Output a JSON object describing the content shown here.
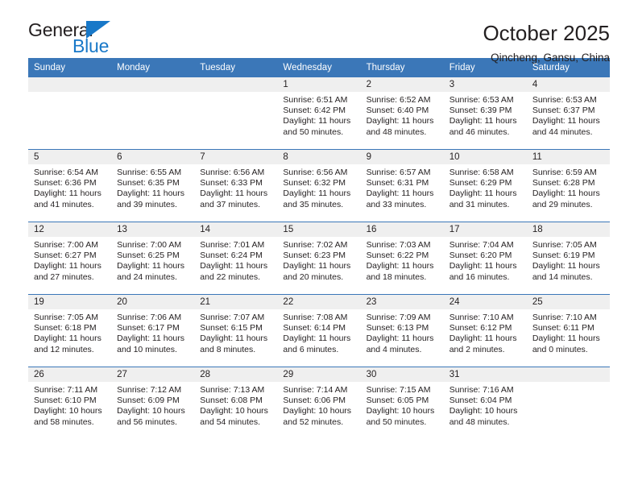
{
  "logo": {
    "word_one": "General",
    "word_two": "Blue",
    "triangle": "blue-triangle",
    "accent_color": "#1878c8"
  },
  "header": {
    "title": "October 2025",
    "subtitle": "Qincheng, Gansu, China"
  },
  "theme": {
    "header_bg": "#3b77b8",
    "header_text": "#ffffff",
    "daynum_bg": "#efefef",
    "cell_bg": "#ffffff",
    "text": "#231f20"
  },
  "weekday_headers": [
    "Sunday",
    "Monday",
    "Tuesday",
    "Wednesday",
    "Thursday",
    "Friday",
    "Saturday"
  ],
  "weeks": [
    [
      {
        "day": "",
        "sunrise": "",
        "sunset": "",
        "daylight_line1": "",
        "daylight_line2": ""
      },
      {
        "day": "",
        "sunrise": "",
        "sunset": "",
        "daylight_line1": "",
        "daylight_line2": ""
      },
      {
        "day": "",
        "sunrise": "",
        "sunset": "",
        "daylight_line1": "",
        "daylight_line2": ""
      },
      {
        "day": "1",
        "sunrise": "Sunrise: 6:51 AM",
        "sunset": "Sunset: 6:42 PM",
        "daylight_line1": "Daylight: 11 hours",
        "daylight_line2": "and 50 minutes."
      },
      {
        "day": "2",
        "sunrise": "Sunrise: 6:52 AM",
        "sunset": "Sunset: 6:40 PM",
        "daylight_line1": "Daylight: 11 hours",
        "daylight_line2": "and 48 minutes."
      },
      {
        "day": "3",
        "sunrise": "Sunrise: 6:53 AM",
        "sunset": "Sunset: 6:39 PM",
        "daylight_line1": "Daylight: 11 hours",
        "daylight_line2": "and 46 minutes."
      },
      {
        "day": "4",
        "sunrise": "Sunrise: 6:53 AM",
        "sunset": "Sunset: 6:37 PM",
        "daylight_line1": "Daylight: 11 hours",
        "daylight_line2": "and 44 minutes."
      }
    ],
    [
      {
        "day": "5",
        "sunrise": "Sunrise: 6:54 AM",
        "sunset": "Sunset: 6:36 PM",
        "daylight_line1": "Daylight: 11 hours",
        "daylight_line2": "and 41 minutes."
      },
      {
        "day": "6",
        "sunrise": "Sunrise: 6:55 AM",
        "sunset": "Sunset: 6:35 PM",
        "daylight_line1": "Daylight: 11 hours",
        "daylight_line2": "and 39 minutes."
      },
      {
        "day": "7",
        "sunrise": "Sunrise: 6:56 AM",
        "sunset": "Sunset: 6:33 PM",
        "daylight_line1": "Daylight: 11 hours",
        "daylight_line2": "and 37 minutes."
      },
      {
        "day": "8",
        "sunrise": "Sunrise: 6:56 AM",
        "sunset": "Sunset: 6:32 PM",
        "daylight_line1": "Daylight: 11 hours",
        "daylight_line2": "and 35 minutes."
      },
      {
        "day": "9",
        "sunrise": "Sunrise: 6:57 AM",
        "sunset": "Sunset: 6:31 PM",
        "daylight_line1": "Daylight: 11 hours",
        "daylight_line2": "and 33 minutes."
      },
      {
        "day": "10",
        "sunrise": "Sunrise: 6:58 AM",
        "sunset": "Sunset: 6:29 PM",
        "daylight_line1": "Daylight: 11 hours",
        "daylight_line2": "and 31 minutes."
      },
      {
        "day": "11",
        "sunrise": "Sunrise: 6:59 AM",
        "sunset": "Sunset: 6:28 PM",
        "daylight_line1": "Daylight: 11 hours",
        "daylight_line2": "and 29 minutes."
      }
    ],
    [
      {
        "day": "12",
        "sunrise": "Sunrise: 7:00 AM",
        "sunset": "Sunset: 6:27 PM",
        "daylight_line1": "Daylight: 11 hours",
        "daylight_line2": "and 27 minutes."
      },
      {
        "day": "13",
        "sunrise": "Sunrise: 7:00 AM",
        "sunset": "Sunset: 6:25 PM",
        "daylight_line1": "Daylight: 11 hours",
        "daylight_line2": "and 24 minutes."
      },
      {
        "day": "14",
        "sunrise": "Sunrise: 7:01 AM",
        "sunset": "Sunset: 6:24 PM",
        "daylight_line1": "Daylight: 11 hours",
        "daylight_line2": "and 22 minutes."
      },
      {
        "day": "15",
        "sunrise": "Sunrise: 7:02 AM",
        "sunset": "Sunset: 6:23 PM",
        "daylight_line1": "Daylight: 11 hours",
        "daylight_line2": "and 20 minutes."
      },
      {
        "day": "16",
        "sunrise": "Sunrise: 7:03 AM",
        "sunset": "Sunset: 6:22 PM",
        "daylight_line1": "Daylight: 11 hours",
        "daylight_line2": "and 18 minutes."
      },
      {
        "day": "17",
        "sunrise": "Sunrise: 7:04 AM",
        "sunset": "Sunset: 6:20 PM",
        "daylight_line1": "Daylight: 11 hours",
        "daylight_line2": "and 16 minutes."
      },
      {
        "day": "18",
        "sunrise": "Sunrise: 7:05 AM",
        "sunset": "Sunset: 6:19 PM",
        "daylight_line1": "Daylight: 11 hours",
        "daylight_line2": "and 14 minutes."
      }
    ],
    [
      {
        "day": "19",
        "sunrise": "Sunrise: 7:05 AM",
        "sunset": "Sunset: 6:18 PM",
        "daylight_line1": "Daylight: 11 hours",
        "daylight_line2": "and 12 minutes."
      },
      {
        "day": "20",
        "sunrise": "Sunrise: 7:06 AM",
        "sunset": "Sunset: 6:17 PM",
        "daylight_line1": "Daylight: 11 hours",
        "daylight_line2": "and 10 minutes."
      },
      {
        "day": "21",
        "sunrise": "Sunrise: 7:07 AM",
        "sunset": "Sunset: 6:15 PM",
        "daylight_line1": "Daylight: 11 hours",
        "daylight_line2": "and 8 minutes."
      },
      {
        "day": "22",
        "sunrise": "Sunrise: 7:08 AM",
        "sunset": "Sunset: 6:14 PM",
        "daylight_line1": "Daylight: 11 hours",
        "daylight_line2": "and 6 minutes."
      },
      {
        "day": "23",
        "sunrise": "Sunrise: 7:09 AM",
        "sunset": "Sunset: 6:13 PM",
        "daylight_line1": "Daylight: 11 hours",
        "daylight_line2": "and 4 minutes."
      },
      {
        "day": "24",
        "sunrise": "Sunrise: 7:10 AM",
        "sunset": "Sunset: 6:12 PM",
        "daylight_line1": "Daylight: 11 hours",
        "daylight_line2": "and 2 minutes."
      },
      {
        "day": "25",
        "sunrise": "Sunrise: 7:10 AM",
        "sunset": "Sunset: 6:11 PM",
        "daylight_line1": "Daylight: 11 hours",
        "daylight_line2": "and 0 minutes."
      }
    ],
    [
      {
        "day": "26",
        "sunrise": "Sunrise: 7:11 AM",
        "sunset": "Sunset: 6:10 PM",
        "daylight_line1": "Daylight: 10 hours",
        "daylight_line2": "and 58 minutes."
      },
      {
        "day": "27",
        "sunrise": "Sunrise: 7:12 AM",
        "sunset": "Sunset: 6:09 PM",
        "daylight_line1": "Daylight: 10 hours",
        "daylight_line2": "and 56 minutes."
      },
      {
        "day": "28",
        "sunrise": "Sunrise: 7:13 AM",
        "sunset": "Sunset: 6:08 PM",
        "daylight_line1": "Daylight: 10 hours",
        "daylight_line2": "and 54 minutes."
      },
      {
        "day": "29",
        "sunrise": "Sunrise: 7:14 AM",
        "sunset": "Sunset: 6:06 PM",
        "daylight_line1": "Daylight: 10 hours",
        "daylight_line2": "and 52 minutes."
      },
      {
        "day": "30",
        "sunrise": "Sunrise: 7:15 AM",
        "sunset": "Sunset: 6:05 PM",
        "daylight_line1": "Daylight: 10 hours",
        "daylight_line2": "and 50 minutes."
      },
      {
        "day": "31",
        "sunrise": "Sunrise: 7:16 AM",
        "sunset": "Sunset: 6:04 PM",
        "daylight_line1": "Daylight: 10 hours",
        "daylight_line2": "and 48 minutes."
      },
      {
        "day": "",
        "sunrise": "",
        "sunset": "",
        "daylight_line1": "",
        "daylight_line2": ""
      }
    ]
  ]
}
